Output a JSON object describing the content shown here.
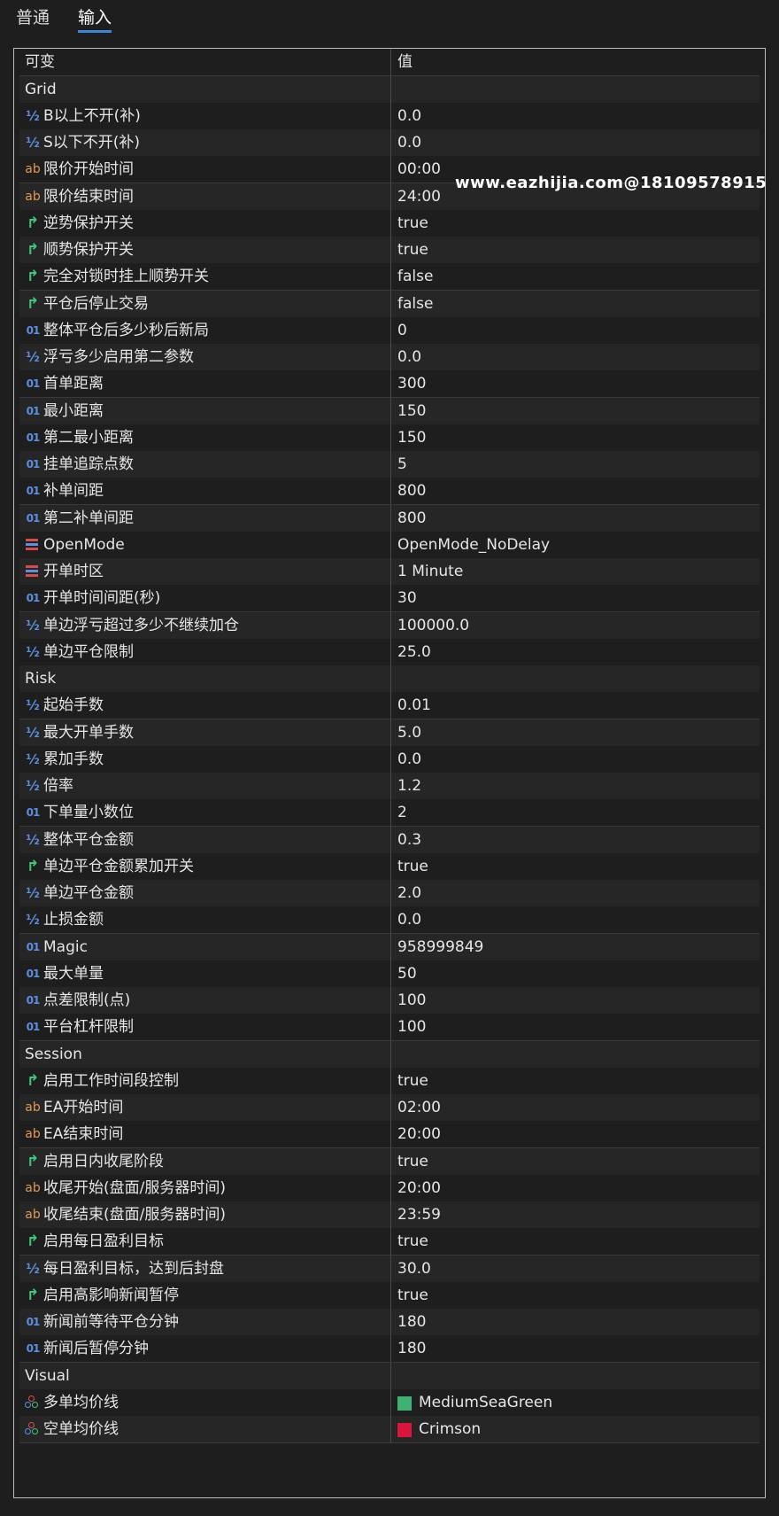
{
  "tabs": [
    "普通",
    "输入"
  ],
  "active_tab": 1,
  "columns": {
    "name": "可变",
    "value": "值"
  },
  "rows": [
    {
      "kind": "section",
      "name": "Grid"
    },
    {
      "kind": "param",
      "icon": "half-icon",
      "name": "B以上不开(补)",
      "value": "0.0"
    },
    {
      "kind": "param",
      "icon": "half-icon",
      "name": "S以下不开(补)",
      "value": "0.0"
    },
    {
      "kind": "param",
      "icon": "ab-icon",
      "name": "限价开始时间",
      "value": "00:00"
    },
    {
      "kind": "param",
      "icon": "ab-icon",
      "name": "限价结束时间",
      "value": "24:00"
    },
    {
      "kind": "param",
      "icon": "bool-icon",
      "name": "逆势保护开关",
      "value": "true"
    },
    {
      "kind": "param",
      "icon": "bool-icon",
      "name": "顺势保护开关",
      "value": "true"
    },
    {
      "kind": "param",
      "icon": "bool-icon",
      "name": "完全对锁时挂上顺势开关",
      "value": "false"
    },
    {
      "kind": "param",
      "icon": "bool-icon",
      "name": "平仓后停止交易",
      "value": "false"
    },
    {
      "kind": "param",
      "icon": "int-icon",
      "name": "整体平仓后多少秒后新局",
      "value": "0"
    },
    {
      "kind": "param",
      "icon": "half-icon",
      "name": "浮亏多少启用第二参数",
      "value": "0.0"
    },
    {
      "kind": "param",
      "icon": "int-icon",
      "name": "首单距离",
      "value": "300"
    },
    {
      "kind": "param",
      "icon": "int-icon",
      "name": "最小距离",
      "value": "150"
    },
    {
      "kind": "param",
      "icon": "int-icon",
      "name": "第二最小距离",
      "value": "150"
    },
    {
      "kind": "param",
      "icon": "int-icon",
      "name": "挂单追踪点数",
      "value": "5"
    },
    {
      "kind": "param",
      "icon": "int-icon",
      "name": "补单间距",
      "value": "800"
    },
    {
      "kind": "param",
      "icon": "int-icon",
      "name": "第二补单间距",
      "value": "800"
    },
    {
      "kind": "param",
      "icon": "enum-icon",
      "name": "OpenMode",
      "value": "OpenMode_NoDelay"
    },
    {
      "kind": "param",
      "icon": "enum-icon",
      "name": "开单时区",
      "value": "1 Minute"
    },
    {
      "kind": "param",
      "icon": "int-icon",
      "name": "开单时间间距(秒)",
      "value": "30"
    },
    {
      "kind": "param",
      "icon": "half-icon",
      "name": "单边浮亏超过多少不继续加仓",
      "value": "100000.0"
    },
    {
      "kind": "param",
      "icon": "half-icon",
      "name": "单边平仓限制",
      "value": "25.0"
    },
    {
      "kind": "section",
      "name": "Risk"
    },
    {
      "kind": "param",
      "icon": "half-icon",
      "name": "起始手数",
      "value": "0.01"
    },
    {
      "kind": "param",
      "icon": "half-icon",
      "name": "最大开单手数",
      "value": "5.0"
    },
    {
      "kind": "param",
      "icon": "half-icon",
      "name": "累加手数",
      "value": "0.0"
    },
    {
      "kind": "param",
      "icon": "half-icon",
      "name": "倍率",
      "value": "1.2"
    },
    {
      "kind": "param",
      "icon": "int-icon",
      "name": "下单量小数位",
      "value": "2"
    },
    {
      "kind": "param",
      "icon": "half-icon",
      "name": "整体平仓金额",
      "value": "0.3"
    },
    {
      "kind": "param",
      "icon": "bool-icon",
      "name": "单边平仓金额累加开关",
      "value": "true"
    },
    {
      "kind": "param",
      "icon": "half-icon",
      "name": "单边平仓金额",
      "value": "2.0"
    },
    {
      "kind": "param",
      "icon": "half-icon",
      "name": "止损金额",
      "value": "0.0"
    },
    {
      "kind": "param",
      "icon": "int-icon",
      "name": "Magic",
      "value": "958999849"
    },
    {
      "kind": "param",
      "icon": "int-icon",
      "name": "最大单量",
      "value": "50"
    },
    {
      "kind": "param",
      "icon": "int-icon",
      "name": "点差限制(点)",
      "value": "100"
    },
    {
      "kind": "param",
      "icon": "int-icon",
      "name": "平台杠杆限制",
      "value": "100"
    },
    {
      "kind": "section",
      "name": "Session"
    },
    {
      "kind": "param",
      "icon": "bool-icon",
      "name": "启用工作时间段控制",
      "value": "true"
    },
    {
      "kind": "param",
      "icon": "ab-icon",
      "name": "EA开始时间",
      "value": "02:00"
    },
    {
      "kind": "param",
      "icon": "ab-icon",
      "name": "EA结束时间",
      "value": "20:00"
    },
    {
      "kind": "param",
      "icon": "bool-icon",
      "name": "启用日内收尾阶段",
      "value": "true"
    },
    {
      "kind": "param",
      "icon": "ab-icon",
      "name": "收尾开始(盘面/服务器时间)",
      "value": "20:00"
    },
    {
      "kind": "param",
      "icon": "ab-icon",
      "name": "收尾结束(盘面/服务器时间)",
      "value": "23:59"
    },
    {
      "kind": "param",
      "icon": "bool-icon",
      "name": "启用每日盈利目标",
      "value": "true"
    },
    {
      "kind": "param",
      "icon": "half-icon",
      "name": "每日盈利目标，达到后封盘",
      "value": "30.0"
    },
    {
      "kind": "param",
      "icon": "bool-icon",
      "name": "启用高影响新闻暂停",
      "value": "true"
    },
    {
      "kind": "param",
      "icon": "int-icon",
      "name": "新闻前等待平仓分钟",
      "value": "180"
    },
    {
      "kind": "param",
      "icon": "int-icon",
      "name": "新闻后暂停分钟",
      "value": "180"
    },
    {
      "kind": "section",
      "name": "Visual"
    },
    {
      "kind": "param",
      "icon": "color-icon",
      "name": "多单均价线",
      "value": "MediumSeaGreen",
      "swatch": "#3cb371"
    },
    {
      "kind": "param",
      "icon": "color-icon",
      "name": "空单均价线",
      "value": "Crimson",
      "swatch": "#dc143c"
    }
  ],
  "watermark": "www.eazhijia.com@18109578915",
  "colors": {
    "background": "#1e1e1e",
    "row_alt": "#262626",
    "accent": "#3b86d6",
    "icon_half": "#5b8fe0",
    "icon_ab": "#e09a50",
    "icon_bool": "#3dc77a"
  }
}
